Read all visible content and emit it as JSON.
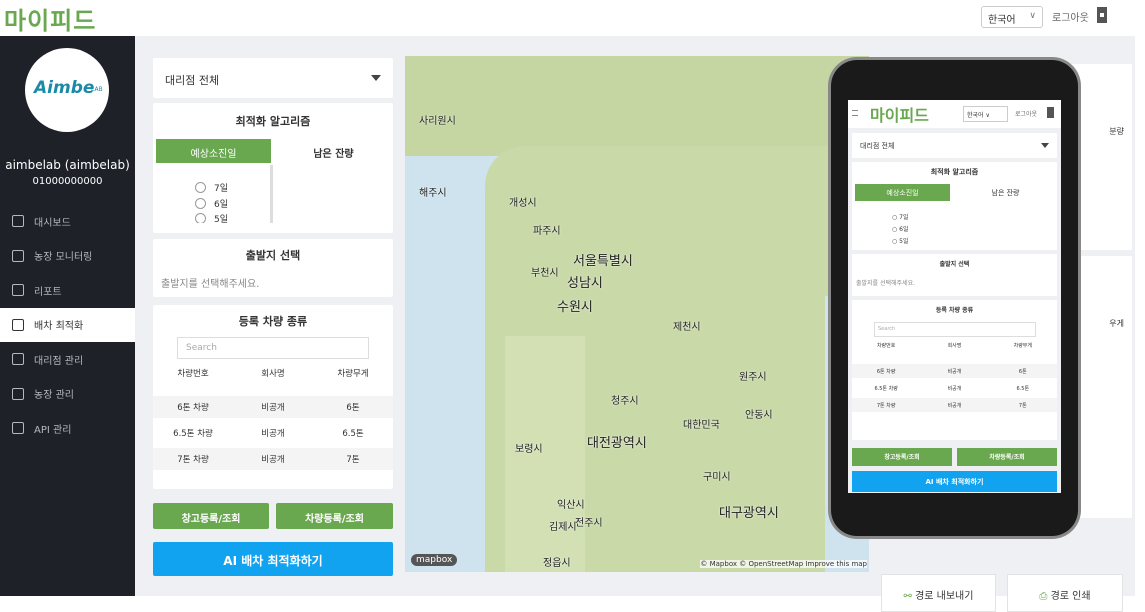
{
  "app": {
    "logo": "마이피드"
  },
  "header": {
    "language": "한국어",
    "logout": "로그아웃"
  },
  "user": {
    "avatar_text": "Aimbe",
    "avatar_sub": "LAB",
    "name": "aimbelab (aimbelab)",
    "phone": "01000000000"
  },
  "sidebar": {
    "items": [
      {
        "label": "대시보드",
        "icon": "dashboard-icon"
      },
      {
        "label": "농장 모니터링",
        "icon": "monitor-icon"
      },
      {
        "label": "리포트",
        "icon": "report-icon"
      },
      {
        "label": "배차 최적화",
        "icon": "truck-icon"
      },
      {
        "label": "대리점 관리",
        "icon": "store-icon"
      },
      {
        "label": "농장 관리",
        "icon": "home-icon"
      },
      {
        "label": "API 관리",
        "icon": "api-icon"
      }
    ],
    "active": "배차 최적화"
  },
  "branch_select": {
    "value": "대리점 전체"
  },
  "algorithm": {
    "title": "최적화 알고리즘",
    "tab_active": "예상소진일",
    "tab_other": "남은 잔량",
    "options": [
      "7일",
      "6일",
      "5일"
    ]
  },
  "departure": {
    "title": "출발지 선택",
    "placeholder": "출발지를 선택해주세요."
  },
  "vehicles": {
    "title": "등록 차량 종류",
    "search_placeholder": "Search",
    "columns": [
      "차량번호",
      "회사명",
      "차량무게"
    ],
    "rows": [
      [
        "6톤 차량",
        "비공개",
        "6톤"
      ],
      [
        "6.5톤 차량",
        "비공개",
        "6.5톤"
      ],
      [
        "7톤 차량",
        "비공개",
        "7톤"
      ]
    ]
  },
  "buttons": {
    "warehouse": "창고등록/조회",
    "vehicle": "차량등록/조회",
    "ai": "AI 배차 최적화하기"
  },
  "map": {
    "logo": "mapbox",
    "attribution": "© Mapbox © OpenStreetMap Improve this map",
    "cities": [
      {
        "n": "서울특별시",
        "big": true
      },
      {
        "n": "수원시",
        "big": true
      },
      {
        "n": "성남시",
        "big": true
      },
      {
        "n": "대전광역시",
        "big": true
      },
      {
        "n": "대구광역시",
        "big": true
      },
      {
        "n": "사리원시"
      },
      {
        "n": "해주시"
      },
      {
        "n": "개성시"
      },
      {
        "n": "파주시"
      },
      {
        "n": "부천시"
      },
      {
        "n": "청주시"
      },
      {
        "n": "대한민국"
      },
      {
        "n": "구미시"
      },
      {
        "n": "전주시"
      },
      {
        "n": "익산시"
      },
      {
        "n": "김제시"
      },
      {
        "n": "보령시"
      },
      {
        "n": "정읍시"
      },
      {
        "n": "제천시"
      },
      {
        "n": "원주시"
      },
      {
        "n": "안동시"
      }
    ]
  },
  "right_panel": {
    "frag1": "분량",
    "frag2": "우게"
  },
  "route_buttons": {
    "export": "경로 내보내기",
    "print": "경로 인쇄"
  },
  "colors": {
    "accent_green": "#6aa84f",
    "accent_blue": "#11a3f0",
    "sidebar_bg": "#1f2129"
  }
}
